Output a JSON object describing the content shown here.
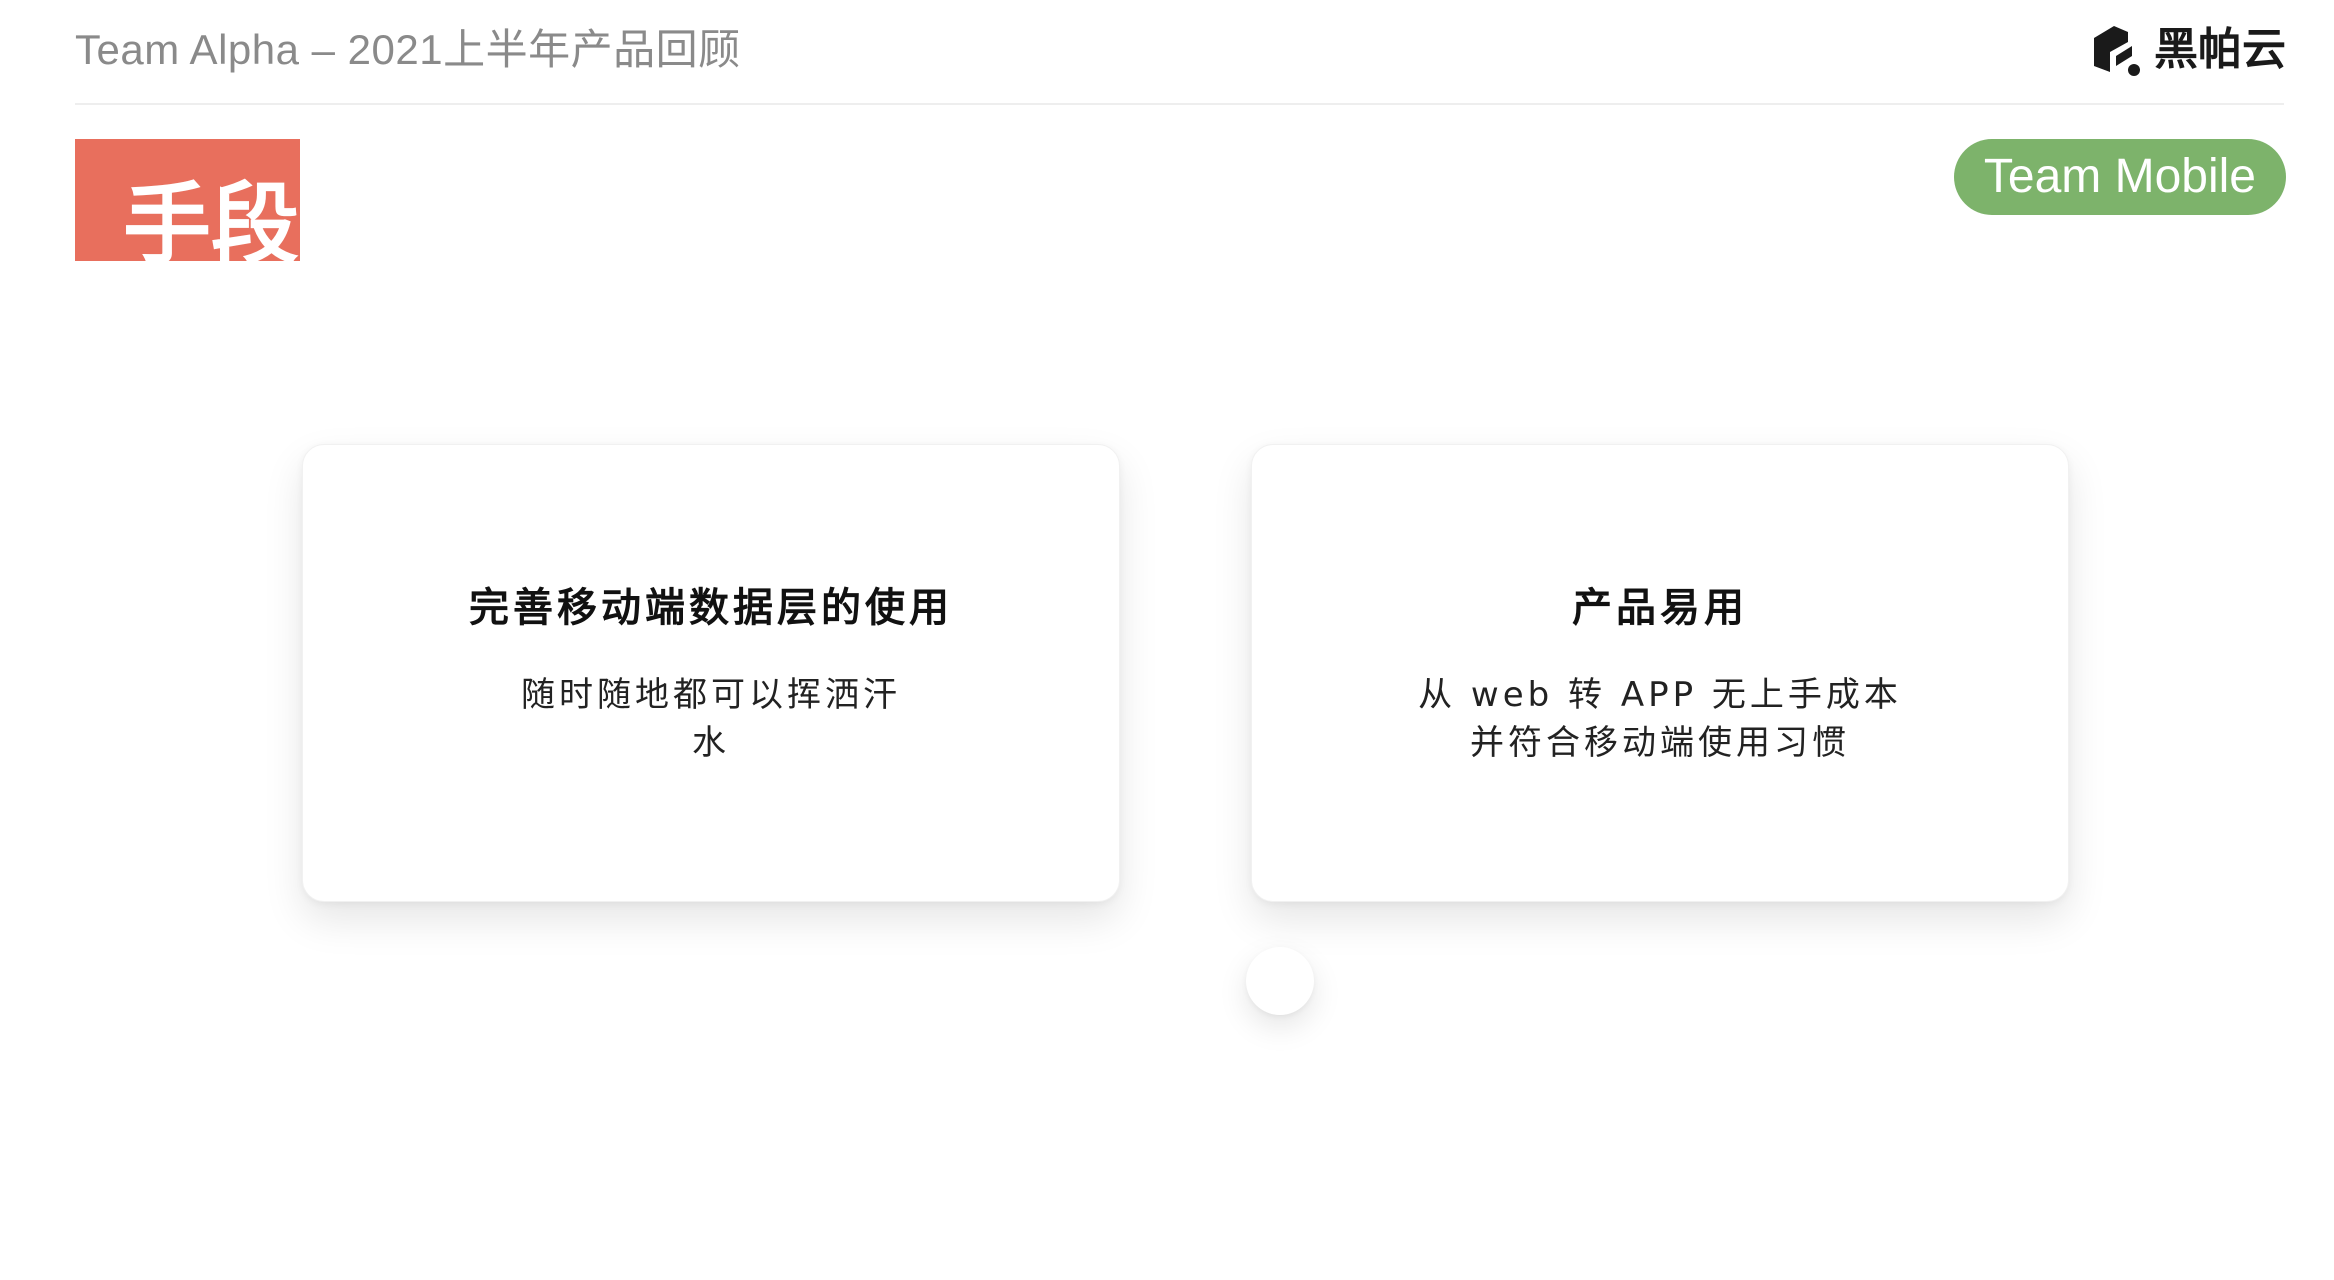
{
  "header": {
    "title": "Team Alpha – 2021上半年产品回顾"
  },
  "logo": {
    "text": "黑帕云",
    "mark_icon": "heipayun-logo-icon"
  },
  "section": {
    "label": "手段"
  },
  "team_badge": {
    "label": "Team Mobile",
    "color": "#7db36b"
  },
  "accent_color": "#e86f5d",
  "cards": [
    {
      "title": "完善移动端数据层的使用",
      "desc_lines": [
        "随时随地都可以挥洒汗",
        "水"
      ]
    },
    {
      "title": "产品易用",
      "desc_lines": [
        "从 web 转 APP 无上手成本",
        "并符合移动端使用习惯"
      ]
    }
  ]
}
